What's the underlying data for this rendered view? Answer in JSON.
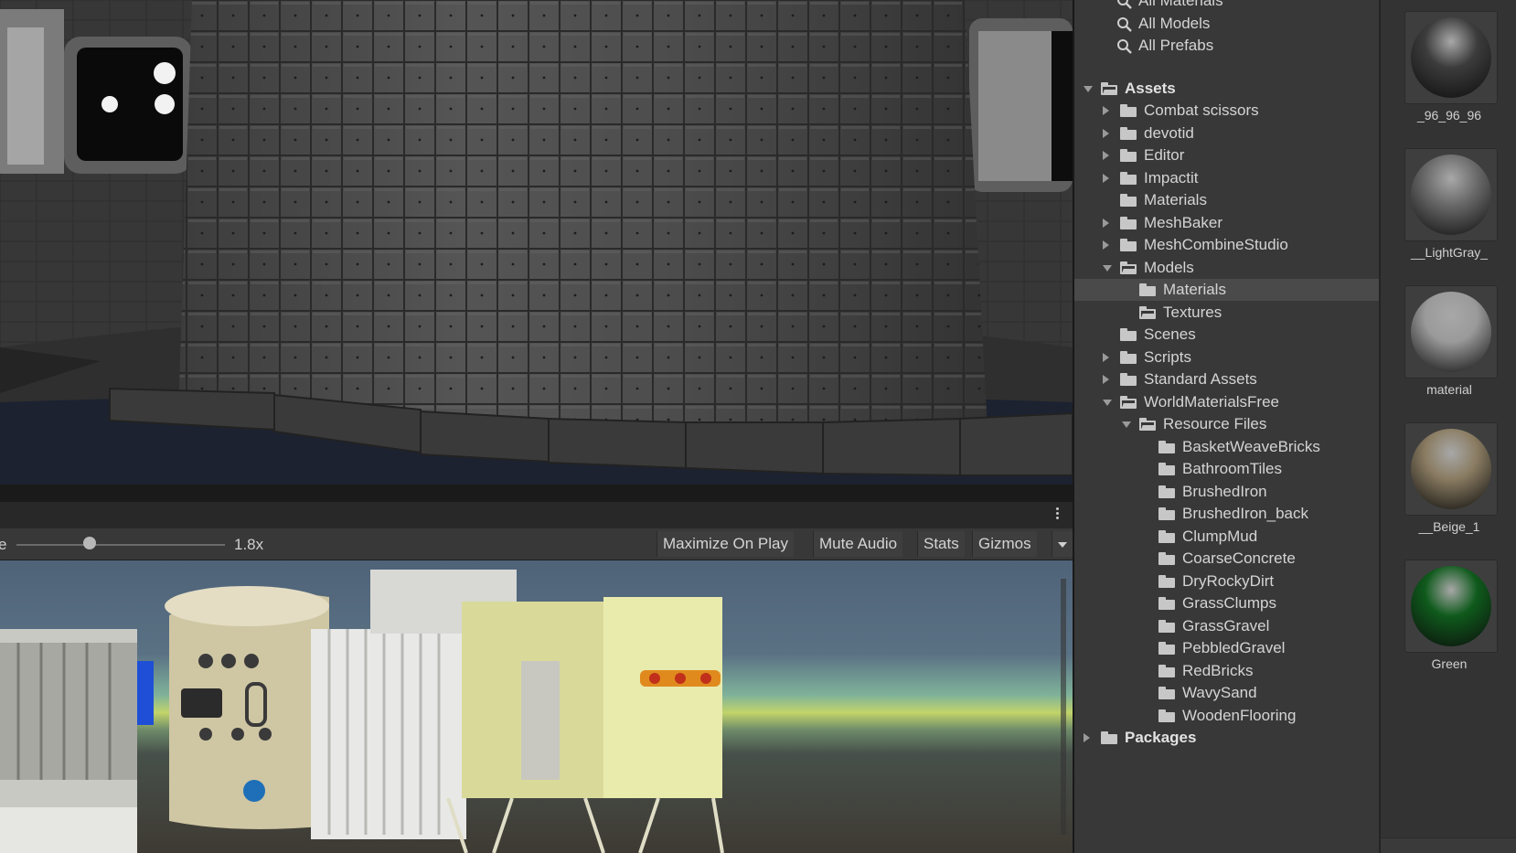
{
  "scene": {
    "background": "#3b3b3b"
  },
  "game_toolbar": {
    "scale_label": "e",
    "scale_value": "1.8x",
    "scale_fraction": 0.35,
    "buttons": [
      "Maximize On Play",
      "Mute Audio",
      "Stats",
      "Gizmos"
    ]
  },
  "project": {
    "search_filters": [
      {
        "label": "All Materials",
        "icon": "search-icon"
      },
      {
        "label": "All Models",
        "icon": "search-icon"
      },
      {
        "label": "All Prefabs",
        "icon": "search-icon"
      }
    ],
    "tree": [
      {
        "label": "Assets",
        "depth": 0,
        "arrow": "down",
        "open": true,
        "bold": true
      },
      {
        "label": "Combat scissors",
        "depth": 1,
        "arrow": "right"
      },
      {
        "label": "devotid",
        "depth": 1,
        "arrow": "right"
      },
      {
        "label": "Editor",
        "depth": 1,
        "arrow": "right"
      },
      {
        "label": "Impactit",
        "depth": 1,
        "arrow": "right"
      },
      {
        "label": "Materials",
        "depth": 1,
        "arrow": "none"
      },
      {
        "label": "MeshBaker",
        "depth": 1,
        "arrow": "right"
      },
      {
        "label": "MeshCombineStudio",
        "depth": 1,
        "arrow": "right"
      },
      {
        "label": "Models",
        "depth": 1,
        "arrow": "down",
        "open": true
      },
      {
        "label": "Materials",
        "depth": 2,
        "arrow": "none",
        "selected": true
      },
      {
        "label": "Textures",
        "depth": 2,
        "arrow": "none",
        "open": true
      },
      {
        "label": "Scenes",
        "depth": 1,
        "arrow": "none"
      },
      {
        "label": "Scripts",
        "depth": 1,
        "arrow": "right"
      },
      {
        "label": "Standard Assets",
        "depth": 1,
        "arrow": "right"
      },
      {
        "label": "WorldMaterialsFree",
        "depth": 1,
        "arrow": "down",
        "open": true
      },
      {
        "label": "Resource Files",
        "depth": 2,
        "arrow": "down",
        "open": true
      },
      {
        "label": "BasketWeaveBricks",
        "depth": 3,
        "arrow": "none"
      },
      {
        "label": "BathroomTiles",
        "depth": 3,
        "arrow": "none"
      },
      {
        "label": "BrushedIron",
        "depth": 3,
        "arrow": "none"
      },
      {
        "label": "BrushedIron_back",
        "depth": 3,
        "arrow": "none"
      },
      {
        "label": "ClumpMud",
        "depth": 3,
        "arrow": "none"
      },
      {
        "label": "CoarseConcrete",
        "depth": 3,
        "arrow": "none"
      },
      {
        "label": "DryRockyDirt",
        "depth": 3,
        "arrow": "none"
      },
      {
        "label": "GrassClumps",
        "depth": 3,
        "arrow": "none"
      },
      {
        "label": "GrassGravel",
        "depth": 3,
        "arrow": "none"
      },
      {
        "label": "PebbledGravel",
        "depth": 3,
        "arrow": "none"
      },
      {
        "label": "RedBricks",
        "depth": 3,
        "arrow": "none"
      },
      {
        "label": "WavySand",
        "depth": 3,
        "arrow": "none"
      },
      {
        "label": "WoodenFlooring",
        "depth": 3,
        "arrow": "none"
      },
      {
        "label": "Packages",
        "depth": 0,
        "arrow": "right",
        "bold": true
      }
    ]
  },
  "assets": [
    {
      "label": "_96_96_96",
      "color": "#3c3c3c"
    },
    {
      "label": "__LightGray_",
      "color": "#6a6a6a"
    },
    {
      "label": "material",
      "color": "#9a9a9a"
    },
    {
      "label": "__Beige_1",
      "color": "#8a7c62"
    },
    {
      "label": "Green",
      "color": "#0f5a1c"
    }
  ]
}
